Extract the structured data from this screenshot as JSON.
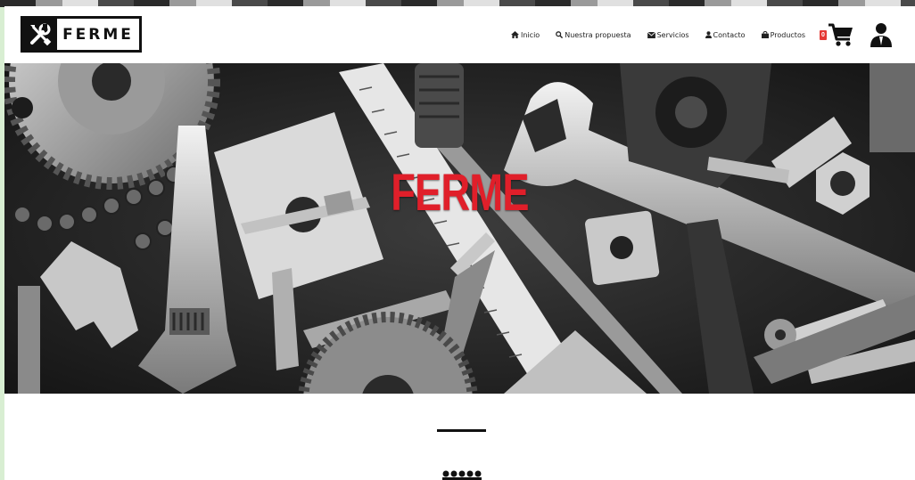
{
  "brand": {
    "name": "FERME",
    "logo_icon": "tools-icon"
  },
  "nav": {
    "items": [
      {
        "label": "Inicio",
        "icon": "home-icon"
      },
      {
        "label": "Nuestra propuesta",
        "icon": "search-icon"
      },
      {
        "label": "Servicios",
        "icon": "envelope-icon"
      },
      {
        "label": "Contacto",
        "icon": "user-icon"
      },
      {
        "label": "Productos",
        "icon": "bag-icon"
      }
    ],
    "cart_count": "0",
    "cart_icon": "shopping-cart-icon",
    "account_icon": "account-icon"
  },
  "hero": {
    "title": "FERME"
  },
  "colors": {
    "accent": "#e01f2a",
    "badge": "#e53935",
    "text": "#111111"
  }
}
